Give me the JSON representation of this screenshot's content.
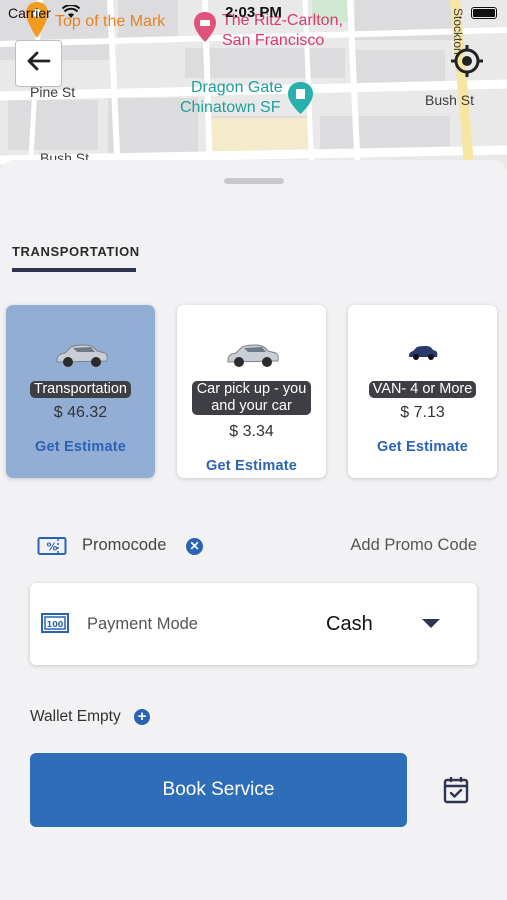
{
  "status_bar": {
    "carrier": "Carrier",
    "time": "2:03 PM"
  },
  "map": {
    "pois": {
      "top_of_mark": "Top of the Mark",
      "ritz_line1": "The Ritz-Carlton,",
      "ritz_line2": "San Francisco",
      "dragon_line1": "Dragon Gate",
      "dragon_line2": "Chinatown SF"
    },
    "streets": {
      "pine": "Pine St",
      "bush_right": "Bush St",
      "bush_left": "Bush St",
      "stockton": "Stockton"
    }
  },
  "tab": {
    "label": "TRANSPORTATION"
  },
  "vehicles": [
    {
      "name": "Transportation",
      "price": "$ 46.32",
      "estimate": "Get Estimate",
      "selected": true
    },
    {
      "name_line1": "Car pick up - you",
      "name_line2": "and your car",
      "price": "$ 3.34",
      "estimate": "Get Estimate",
      "selected": false
    },
    {
      "name": "VAN- 4 or More",
      "price": "$ 7.13",
      "estimate": "Get Estimate",
      "selected": false
    }
  ],
  "promo": {
    "label": "Promocode",
    "add": "Add Promo Code"
  },
  "payment": {
    "label": "Payment Mode",
    "value": "Cash"
  },
  "wallet": {
    "label": "Wallet Empty"
  },
  "actions": {
    "book": "Book Service"
  },
  "colors": {
    "accent": "#2e6db8",
    "selected_card": "#93aed4",
    "dark_navy": "#2f3550"
  }
}
